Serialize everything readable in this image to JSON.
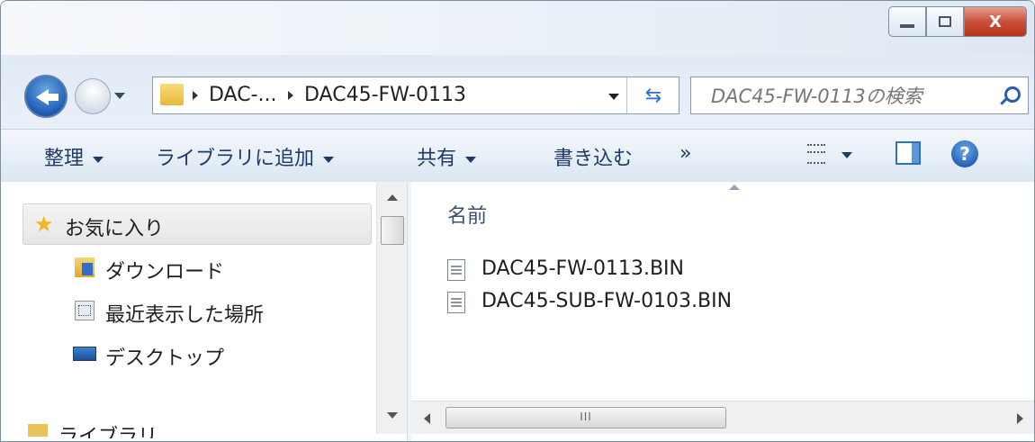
{
  "window": {
    "minimize_label": "",
    "maximize_label": "",
    "close_label": "X"
  },
  "address": {
    "segments": [
      "DAC-...",
      "DAC45-FW-0113"
    ],
    "search_placeholder": "DAC45-FW-0113の検索"
  },
  "toolbar": {
    "items": [
      "整理",
      "ライブラリに追加",
      "共有",
      "書き込む"
    ],
    "more": "»"
  },
  "nav": {
    "favorites": "お気に入り",
    "items": [
      "ダウンロード",
      "最近表示した場所",
      "デスクトップ"
    ],
    "next_section": "ライブラリ"
  },
  "content": {
    "column_header": "名前",
    "files": [
      "DAC45-FW-0113.BIN",
      "DAC45-SUB-FW-0103.BIN"
    ]
  },
  "hscroll": {
    "grip": "III"
  }
}
